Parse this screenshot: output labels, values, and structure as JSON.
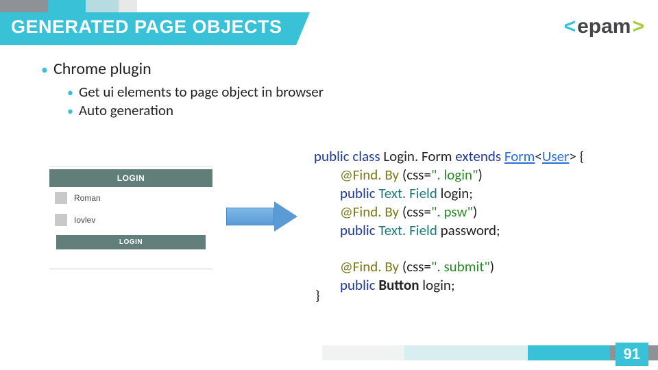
{
  "header": {
    "title": "GENERATED PAGE OBJECTS",
    "logo_bracket_open": "<",
    "logo_text": "epam",
    "logo_bracket_close": ">"
  },
  "bullets": {
    "lvl1_chrome": "Chrome plugin",
    "lvl2_get": "Get ui elements to page object in browser",
    "lvl2_auto": "Auto generation"
  },
  "login": {
    "header": "LOGIN",
    "field1": "Roman",
    "field2": "Iovlev",
    "button": "LOGIN"
  },
  "code": {
    "l1_a": "public class ",
    "l1_b": "Login. Form ",
    "l1_c": "extends ",
    "l1_d": "Form",
    "l1_e": "<",
    "l1_f": "User",
    "l1_g": "> {",
    "l2_a": "@Find. By ",
    "l2_b": "(",
    "l2_c": "css",
    "l2_d": "=",
    "l2_e": "\". login\"",
    "l2_f": ")",
    "l3_a": "public ",
    "l3_b": "Text. Field ",
    "l3_c": "login",
    "l3_d": ";",
    "l4_a": "@Find. By ",
    "l4_b": "(",
    "l4_c": "css",
    "l4_d": "=",
    "l4_e": "\". psw\"",
    "l4_f": ")",
    "l5_a": "public ",
    "l5_b": "Text. Field ",
    "l5_c": "password",
    "l5_d": ";",
    "l6_a": "@Find. By ",
    "l6_b": "(",
    "l6_c": "css",
    "l6_d": "=",
    "l6_e": "\". submit\"",
    "l6_f": ")",
    "l7_a": "public ",
    "l7_b": "Button ",
    "l7_c": "login",
    "l7_d": ";",
    "close": "}"
  },
  "page_number": "91"
}
